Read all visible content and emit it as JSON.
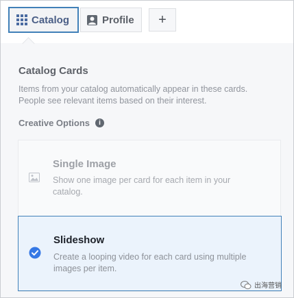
{
  "tabs": [
    {
      "label": "Catalog",
      "icon": "grid-icon",
      "selected": true
    },
    {
      "label": "Profile",
      "icon": "profile-icon",
      "selected": false
    },
    {
      "label": "+",
      "icon": "add-icon",
      "selected": false
    }
  ],
  "section": {
    "title": "Catalog Cards",
    "description": "Items from your catalog automatically appear in these cards. People see relevant items based on their interest."
  },
  "creative_options": {
    "label": "Creative Options",
    "info_icon": "i",
    "options": [
      {
        "title": "Single Image",
        "description": "Show one image per card for each item in your catalog.",
        "icon": "image-icon",
        "selected": false
      },
      {
        "title": "Slideshow",
        "description": "Create a looping video for each card using multiple images per item.",
        "icon": "check-circle-icon",
        "selected": true
      }
    ]
  },
  "watermark": {
    "text": "出海营销"
  },
  "colors": {
    "accent": "#4080b8",
    "check": "#3578e5",
    "panel_bg": "#f6f7f9",
    "selected_bg": "#ebf3fc"
  }
}
